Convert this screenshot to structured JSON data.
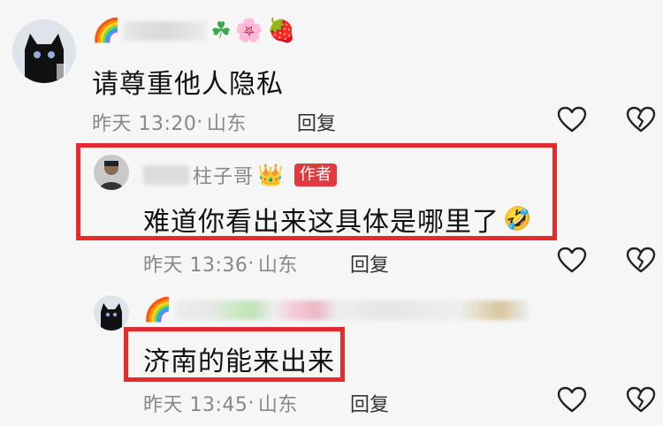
{
  "comments": [
    {
      "name_emojis": [
        "🌈",
        "☘",
        "🌸",
        "🍓"
      ],
      "text": "请尊重他人隐私",
      "time": "昨天 13:20",
      "separator": "·",
      "location": "山东",
      "reply_label": "回复"
    },
    {
      "username": "柱子哥",
      "crown_emoji": "👑",
      "badge": "作者",
      "text": "难道你看出来这具体是哪里了",
      "text_emoji": "🤣",
      "time": "昨天 13:36",
      "separator": "·",
      "location": "山东",
      "reply_label": "回复"
    },
    {
      "name_emojis": [
        "🌈"
      ],
      "text": "济南的能来出来",
      "time": "昨天 13:45",
      "separator": "·",
      "location": "山东",
      "reply_label": "回复"
    }
  ],
  "icons": {
    "like": "heart-outline-icon",
    "dislike": "broken-heart-icon"
  },
  "colors": {
    "highlight_box": "#e42a2a",
    "author_badge": "#e0393e",
    "meta_text": "#888888"
  }
}
